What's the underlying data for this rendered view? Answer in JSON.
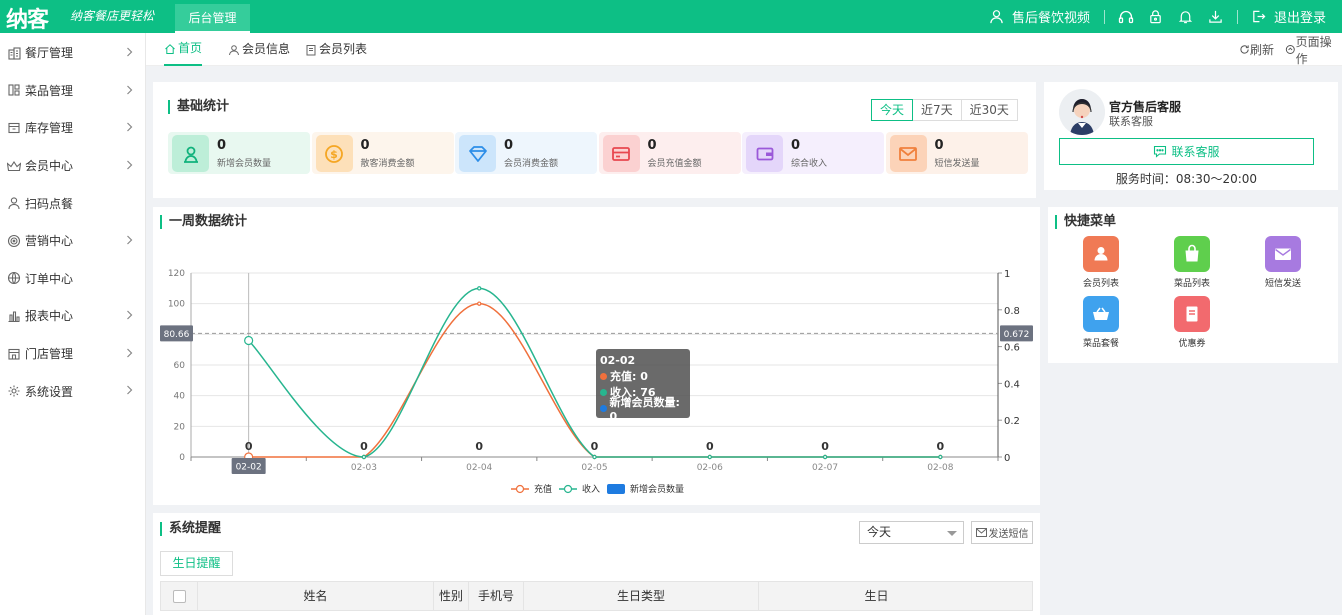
{
  "header": {
    "logo": "纳客",
    "slogan": "纳客餐店更轻松",
    "active_tab": "后台管理",
    "video_label": "售后餐饮视频",
    "logout_label": "退出登录"
  },
  "sidebar": {
    "items": [
      {
        "label": "餐厅管理",
        "icon": "building-icon",
        "has_arrow": true
      },
      {
        "label": "菜品管理",
        "icon": "dish-layout-icon",
        "has_arrow": true
      },
      {
        "label": "库存管理",
        "icon": "inventory-box-icon",
        "has_arrow": true
      },
      {
        "label": "会员中心",
        "icon": "crown-icon",
        "has_arrow": true
      },
      {
        "label": "扫码点餐",
        "icon": "user-icon",
        "has_arrow": false
      },
      {
        "label": "营销中心",
        "icon": "target-icon",
        "has_arrow": true
      },
      {
        "label": "订单中心",
        "icon": "globe-icon",
        "has_arrow": false
      },
      {
        "label": "报表中心",
        "icon": "bar-chart-icon",
        "has_arrow": true
      },
      {
        "label": "门店管理",
        "icon": "store-icon",
        "has_arrow": true
      },
      {
        "label": "系统设置",
        "icon": "gear-icon",
        "has_arrow": true
      }
    ]
  },
  "tabs": {
    "items": [
      {
        "label": "首页",
        "icon": "home-icon"
      },
      {
        "label": "会员信息",
        "icon": "user-icon"
      },
      {
        "label": "会员列表",
        "icon": "doc-icon"
      }
    ],
    "refresh_label": "刷新",
    "page_ops_label": "页面操作"
  },
  "basic_stats": {
    "title": "基础统计",
    "periods": [
      "今天",
      "近7天",
      "近30天"
    ],
    "active_period": "今天",
    "items": [
      {
        "value": "0",
        "label": "新增会员数量",
        "icon": "user-icon",
        "bg": "#e8f8f0",
        "icon_bg": "#bdeed8",
        "icon_color": "#11b27c"
      },
      {
        "value": "0",
        "label": "散客消费金额",
        "icon": "coin-icon",
        "bg": "#fdf5ec",
        "icon_bg": "#fde0b9",
        "icon_color": "#f5a623"
      },
      {
        "value": "0",
        "label": "会员消费金额",
        "icon": "diamond-icon",
        "bg": "#eef6fd",
        "icon_bg": "#cce5fb",
        "icon_color": "#2d8ee8"
      },
      {
        "value": "0",
        "label": "会员充值金额",
        "icon": "card-icon",
        "bg": "#fdeeee",
        "icon_bg": "#fbd1d1",
        "icon_color": "#e8474f"
      },
      {
        "value": "0",
        "label": "综合收入",
        "icon": "wallet-icon",
        "bg": "#f5effd",
        "icon_bg": "#e4d6fa",
        "icon_color": "#9b59d9"
      },
      {
        "value": "0",
        "label": "短信发送量",
        "icon": "mail-icon",
        "bg": "#fdf1e9",
        "icon_bg": "#fcd3b8",
        "icon_color": "#f0803c"
      }
    ]
  },
  "service": {
    "name": "官方售后客服",
    "subtitle": "联系客服",
    "button_label": "联系客服",
    "hours": "服务时间：08:30～20:00"
  },
  "week_chart": {
    "title": "一周数据统计",
    "tooltip": {
      "date": "02-02",
      "rows": [
        {
          "text": "充值: 0",
          "color": "#f0703c"
        },
        {
          "text": "收入: 76",
          "color": "#27b58f"
        },
        {
          "text": "新增会员数量: 0",
          "color": "#1e7be0"
        }
      ]
    },
    "marker_left": "80.66",
    "marker_right": "0.672",
    "x_marker": "02-02"
  },
  "chart_data": {
    "type": "line",
    "title": "一周数据统计",
    "categories": [
      "02-02",
      "02-03",
      "02-04",
      "02-05",
      "02-06",
      "02-07",
      "02-08"
    ],
    "series": [
      {
        "name": "充值",
        "type": "line",
        "axis": "left",
        "color": "#f0703c",
        "values": [
          0,
          0,
          100,
          0,
          0,
          0,
          0
        ]
      },
      {
        "name": "收入",
        "type": "line",
        "axis": "left",
        "color": "#27b58f",
        "values": [
          76,
          0,
          110,
          0,
          0,
          0,
          0
        ]
      },
      {
        "name": "新增会员数量",
        "type": "bar",
        "axis": "right",
        "color": "#1e7be0",
        "values": [
          0,
          0,
          0,
          0,
          0,
          0,
          0
        ]
      }
    ],
    "left_ticks": [
      "0",
      "20",
      "40",
      "60",
      "80",
      "100",
      "120"
    ],
    "right_ticks": [
      "0",
      "0.2",
      "0.4",
      "0.6",
      "0.8",
      "1"
    ],
    "ylim_left": [
      0,
      120
    ],
    "ylim_right": [
      0,
      1
    ],
    "bar_labels": [
      "0",
      "0",
      "0",
      "0",
      "0",
      "0",
      "0"
    ],
    "smooth": true,
    "grid": true,
    "legend": "bottom"
  },
  "quick_menu": {
    "title": "快捷菜单",
    "items": [
      {
        "label": "会员列表",
        "icon": "user-icon",
        "color": "#f07a55"
      },
      {
        "label": "菜品列表",
        "icon": "bag-icon",
        "color": "#5fcf4d"
      },
      {
        "label": "短信发送",
        "icon": "mail-icon",
        "color": "#a77ae0"
      },
      {
        "label": "菜品套餐",
        "icon": "basket-icon",
        "color": "#3fa2ee"
      },
      {
        "label": "优惠券",
        "icon": "coupon-icon",
        "color": "#f26a6e"
      }
    ]
  },
  "reminders": {
    "title": "系统提醒",
    "select_value": "今天",
    "sms_button": "发送短信",
    "sub_tab": "生日提醒",
    "columns": [
      "姓名",
      "性别",
      "手机号",
      "生日类型",
      "生日"
    ]
  }
}
